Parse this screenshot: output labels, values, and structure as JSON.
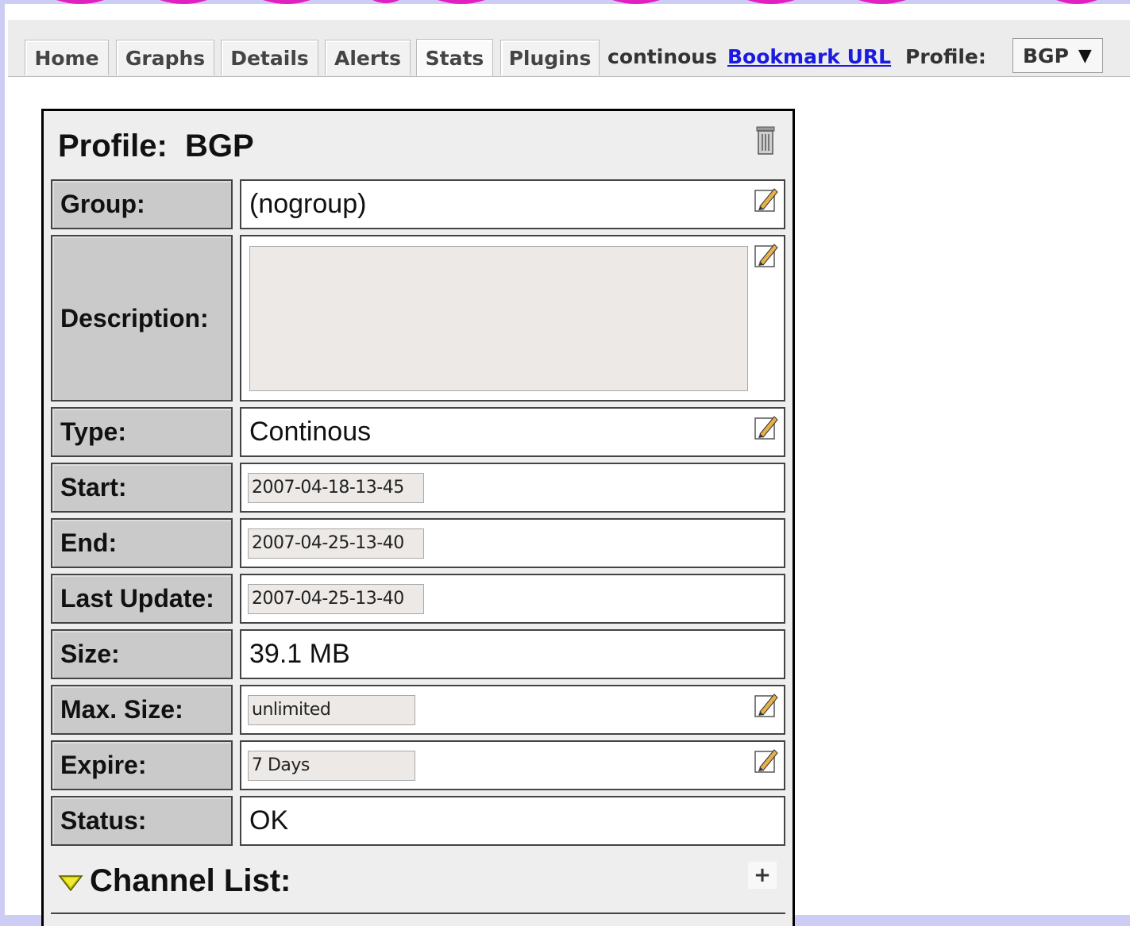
{
  "nav": {
    "tabs": [
      {
        "label": "Home"
      },
      {
        "label": "Graphs"
      },
      {
        "label": "Details"
      },
      {
        "label": "Alerts"
      },
      {
        "label": "Stats",
        "active": true
      },
      {
        "label": "Plugins"
      }
    ],
    "mode_text": "continous",
    "bookmark_label": "Bookmark URL",
    "profile_label": "Profile:",
    "profile_value": "BGP",
    "profile_arrow": "▼"
  },
  "profile": {
    "title_prefix": "Profile:",
    "title_name": "BGP",
    "fields": {
      "group": {
        "label": "Group:",
        "value": "(nogroup)"
      },
      "description": {
        "label": "Description:",
        "value": ""
      },
      "type": {
        "label": "Type:",
        "value": "Continous"
      },
      "start": {
        "label": "Start:",
        "value": "2007-04-18-13-45"
      },
      "end": {
        "label": "End:",
        "value": "2007-04-25-13-40"
      },
      "last_update": {
        "label": "Last Update:",
        "value": "2007-04-25-13-40"
      },
      "size": {
        "label": "Size:",
        "value": "39.1 MB"
      },
      "max_size": {
        "label": "Max. Size:",
        "value": "unlimited"
      },
      "expire": {
        "label": "Expire:",
        "value": "7 Days"
      },
      "status": {
        "label": "Status:",
        "value": "OK"
      }
    },
    "channel_list_label": "Channel List:",
    "add_channel_label": "+"
  },
  "icons": {
    "delete": "trash-icon",
    "edit": "edit-icon",
    "expand": "triangle-down-icon"
  },
  "colors": {
    "accent_top": "#e020c0",
    "link": "#1a1ae0",
    "background": "#ccccf4"
  }
}
